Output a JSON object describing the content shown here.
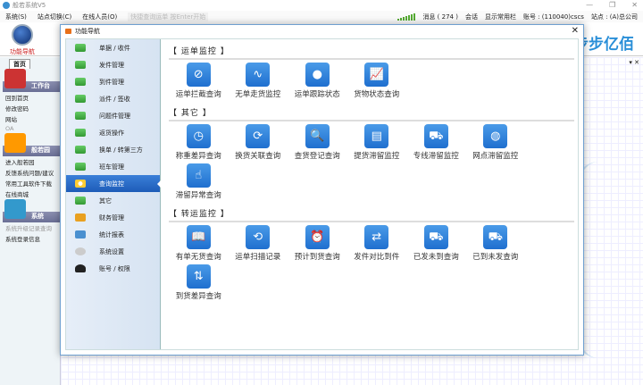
{
  "window": {
    "title": "般若系统V5",
    "controls": [
      "—",
      "❐",
      "✕"
    ]
  },
  "menu": {
    "items": [
      "系统(S)",
      "站点切换(C)",
      "在线人员(O)"
    ],
    "quick_search_placeholder": "快捷查询运单  按Enter开始"
  },
  "status": {
    "messages": "消息 ( 274 )",
    "session": "会话",
    "show_toolbar": "显示常用栏",
    "account": "账号 : (110040)cscs",
    "site": "站点 : (A)总公司"
  },
  "toolbar": {
    "nav_label": "功能导航",
    "brand": "步步亿佰"
  },
  "left": {
    "tab": "首页",
    "groups": [
      {
        "title": "工作台",
        "links": [
          "回到首页",
          "修改密码",
          "网站",
          "OA"
        ]
      },
      {
        "title": "般若园",
        "links": [
          "进入般若园",
          "反馈系统问题/建议",
          "常用工具软件下载",
          "在线商城"
        ]
      },
      {
        "title": "系统",
        "links": [
          "系统升级记录查询",
          "系统登录信息"
        ]
      }
    ]
  },
  "dialog": {
    "title": "功能导航",
    "close": "✕",
    "sidebar": [
      "单据 / 收件",
      "发件管理",
      "到件管理",
      "派件 / 签收",
      "问题件管理",
      "返货操作",
      "换单 / 转第三方",
      "班车管理",
      "查询监控",
      "其它",
      "财务管理",
      "统计报表",
      "系统设置",
      "账号 / 权限"
    ],
    "active_index": 8,
    "sections": [
      {
        "title": "【  运单监控  】",
        "items": [
          {
            "label": "运单拦截查询",
            "icon": "⊘"
          },
          {
            "label": "无单走货监控",
            "icon": "∿"
          },
          {
            "label": "运单跟踪状态",
            "icon": "●"
          },
          {
            "label": "货物状态查询",
            "icon": "📈"
          }
        ]
      },
      {
        "title": "【  其它  】",
        "items": [
          {
            "label": "称重差异查询",
            "icon": "◷"
          },
          {
            "label": "换货关联查询",
            "icon": "⟳"
          },
          {
            "label": "查货登记查询",
            "icon": "🔍"
          },
          {
            "label": "提货滞留监控",
            "icon": "▤"
          },
          {
            "label": "专线滞留监控",
            "icon": "⛟"
          },
          {
            "label": "网点滞留监控",
            "icon": "◍"
          },
          {
            "label": "滞留异常查询",
            "icon": "☝"
          }
        ]
      },
      {
        "title": "【  转运监控  】",
        "items": [
          {
            "label": "有单无货查询",
            "icon": "📖"
          },
          {
            "label": "运单扫描记录",
            "icon": "⟲"
          },
          {
            "label": "预计到货查询",
            "icon": "⏰"
          },
          {
            "label": "发件对比到件",
            "icon": "⇄"
          },
          {
            "label": "已发未到查询",
            "icon": "⛟"
          },
          {
            "label": "已到未发查询",
            "icon": "⛟"
          },
          {
            "label": "到货差异查询",
            "icon": "⇅"
          }
        ]
      }
    ]
  }
}
